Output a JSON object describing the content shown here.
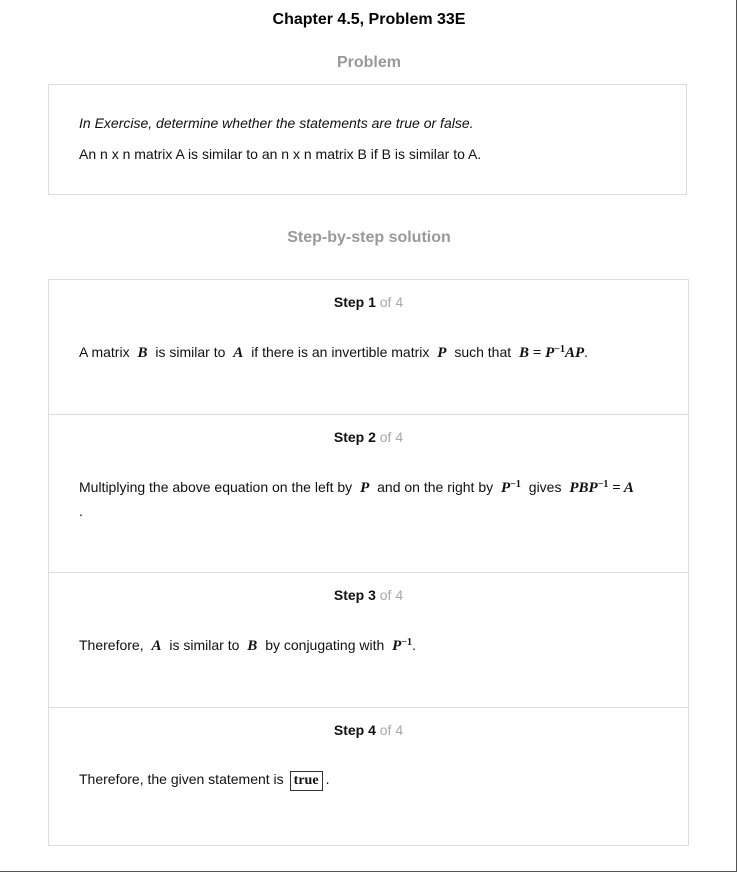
{
  "header": {
    "title": "Chapter 4.5, Problem 33E"
  },
  "problem": {
    "heading": "Problem",
    "instruction": "In Exercise, determine whether the statements are true or false.",
    "statement": "An n x n matrix A is similar to an n x n matrix B if B is similar to A."
  },
  "solution": {
    "heading": "Step-by-step solution",
    "steps": [
      {
        "word": "Step 1",
        "of": "of 4",
        "t1": "A matrix",
        "m1": "B",
        "t2": "is similar to",
        "m2": "A",
        "t3": "if there is an invertible matrix",
        "m3": "P",
        "t4": "such that",
        "m4a": "B = P",
        "m4sup": "−1",
        "m4b": "AP",
        "t5": "."
      },
      {
        "word": "Step 2",
        "of": "of 4",
        "t1": "Multiplying the above equation on the left by",
        "m1": "P",
        "t2": "and on the right by",
        "m2a": "P",
        "m2sup": "−1",
        "t3": "gives",
        "m3a": "PBP",
        "m3sup": "−1",
        "m3b": "= A",
        "t4": "."
      },
      {
        "word": "Step 3",
        "of": "of 4",
        "t1": "Therefore,",
        "m1": "A",
        "t2": "is similar to",
        "m2": "B",
        "t3": "by conjugating with",
        "m3a": "P",
        "m3sup": "−1",
        "t4": "."
      },
      {
        "word": "Step 4",
        "of": "of 4",
        "t1": "Therefore, the given statement is",
        "answer": "true",
        "t2": "."
      }
    ]
  }
}
